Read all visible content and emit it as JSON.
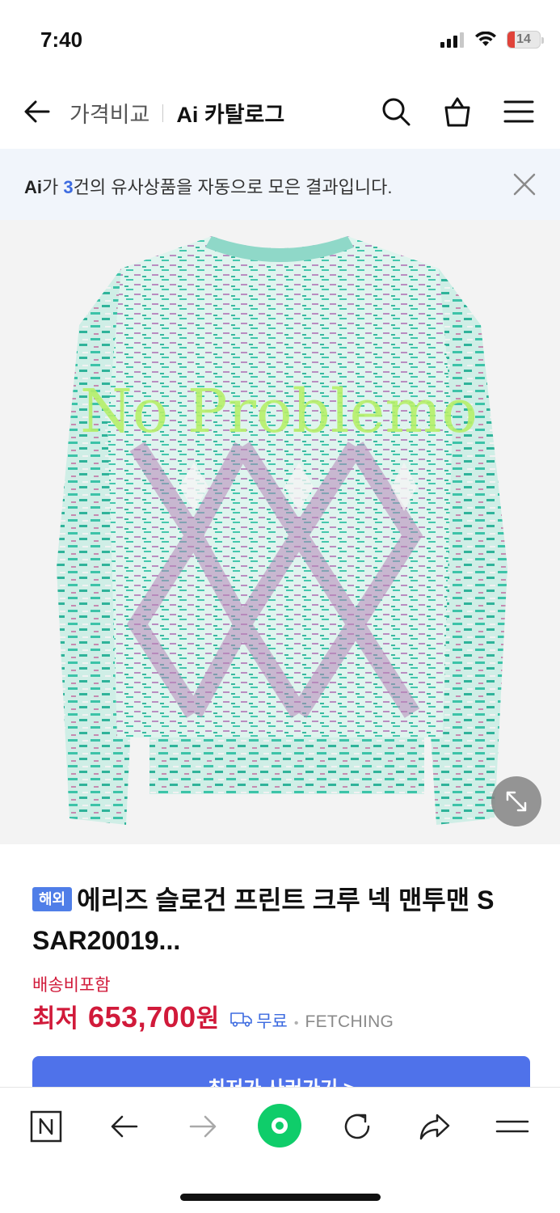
{
  "status_bar": {
    "time": "7:40",
    "battery_level": "14",
    "icons": [
      "signal-icon",
      "wifi-icon",
      "battery-icon"
    ]
  },
  "header": {
    "back_icon": "arrow-left-icon",
    "price_compare": "가격비교",
    "catalog": "Ai 카탈로그",
    "icons": [
      "search-icon",
      "shopping-bag-icon",
      "menu-icon"
    ]
  },
  "ai_banner": {
    "badge": "Ai",
    "prefix": "가 ",
    "count": "3",
    "suffix": "건의 유사상품을 자동으로 모은 결과입니다.",
    "close_icon": "close-icon"
  },
  "product": {
    "image_alt": "No Problemo knit sweater",
    "sweater_text": "No Problemo",
    "expand_icon": "expand-icon",
    "badge": "해외",
    "title": "에리즈 슬로건 프린트 크루 넥 맨투맨 S SAR20019...",
    "shipping_included": "배송비포함",
    "price_label": "최저",
    "price": "653,700",
    "currency": "원",
    "shipping": "무료",
    "separator": "•",
    "seller": "FETCHING",
    "buy_button": "최저가 사러가기 >"
  },
  "bottom_nav": {
    "items": [
      "naver-icon",
      "back-arrow-icon",
      "forward-arrow-icon",
      "home-green-icon",
      "refresh-icon",
      "share-icon",
      "menu-lines-icon"
    ]
  },
  "colors": {
    "accent_blue": "#4f72ea",
    "price_red": "#d11a3a",
    "naver_green": "#0fcd6a",
    "banner_bg": "#f1f5fb"
  }
}
